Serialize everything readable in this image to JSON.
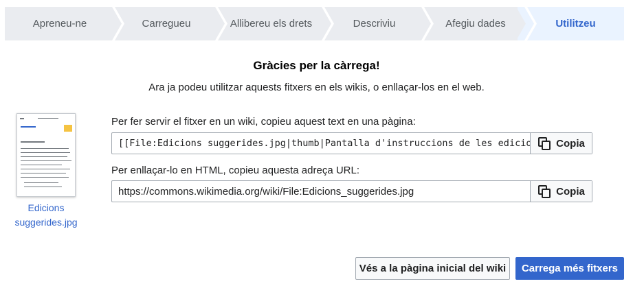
{
  "steps": [
    {
      "label": "Apreneu-ne"
    },
    {
      "label": "Carregueu"
    },
    {
      "label": "Allibereu els drets"
    },
    {
      "label": "Descriviu"
    },
    {
      "label": "Afegiu dades"
    },
    {
      "label": "Utilitzeu",
      "active": true
    }
  ],
  "title": "Gràcies per la càrrega!",
  "subtitle": "Ara ja podeu utilitzar aquests fitxers en els wikis, o enllaçar-los en el web.",
  "file": {
    "caption": "Edicions suggerides.jpg"
  },
  "wiki_usage": {
    "label": "Per fer servir el fitxer en un wiki, copieu aquest text en una pàgina:",
    "value": "[[File:Edicions suggerides.jpg|thumb|Pantalla d'instruccions de les edicions",
    "copy_label": "Copia"
  },
  "html_usage": {
    "label": "Per enllaçar-lo en HTML, copieu aquesta adreça URL:",
    "value": "https://commons.wikimedia.org/wiki/File:Edicions_suggerides.jpg",
    "copy_label": "Copia"
  },
  "buttons": {
    "home": "Vés a la pàgina inicial del wiki",
    "more": "Carrega més fitxers"
  },
  "colors": {
    "accent": "#3366cc",
    "step_bg": "#eaecf0",
    "active_step_bg": "#eaf3ff"
  },
  "icons": {
    "copy": "copy-icon",
    "step_separator": "chevron-right-icon"
  }
}
